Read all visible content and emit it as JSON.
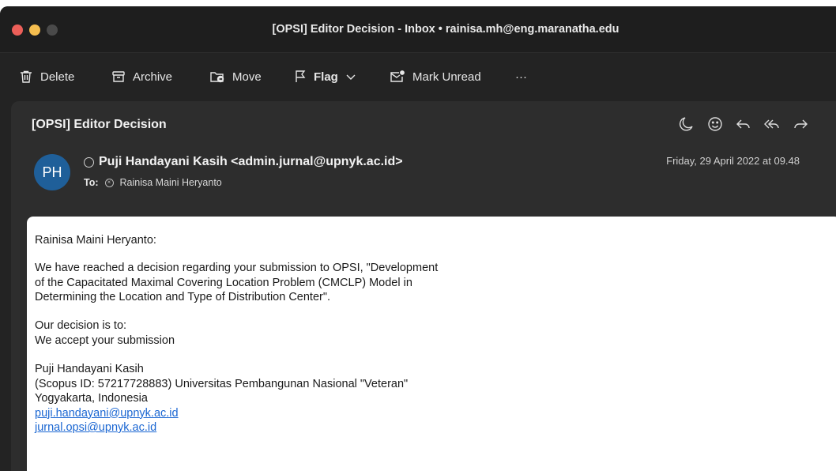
{
  "window": {
    "title": "[OPSI] Editor Decision - Inbox • rainisa.mh@eng.maranatha.edu"
  },
  "toolbar": {
    "delete_label": "Delete",
    "archive_label": "Archive",
    "move_label": "Move",
    "flag_label": "Flag",
    "mark_unread_label": "Mark Unread",
    "more_label": "···"
  },
  "message": {
    "subject": "[OPSI] Editor Decision",
    "avatar_initials": "PH",
    "avatar_color": "#1f5f99",
    "sender": "Puji Handayani Kasih <admin.jurnal@upnyk.ac.id>",
    "to_label": "To:",
    "recipient": "Rainisa Maini Heryanto",
    "date": "Friday, 29 April 2022 at 09.48"
  },
  "body": {
    "greeting": "Rainisa Maini Heryanto:",
    "para1_line1": "We have reached a decision regarding your submission to OPSI, \"Development",
    "para1_line2": "of the Capacitated Maximal Covering Location Problem (CMCLP) Model in",
    "para1_line3": "Determining the Location and Type of Distribution Center\".",
    "decision_line1": "Our decision is to:",
    "decision_line2": "We accept your submission",
    "sig_name": "Puji Handayani Kasih",
    "sig_line2": "(Scopus ID: 57217728883) Universitas Pembangunan Nasional \"Veteran\"",
    "sig_line3": "Yogyakarta, Indonesia",
    "sig_email1": "puji.handayani@upnyk.ac.id",
    "sig_email2": "jurnal.opsi@upnyk.ac.id"
  }
}
